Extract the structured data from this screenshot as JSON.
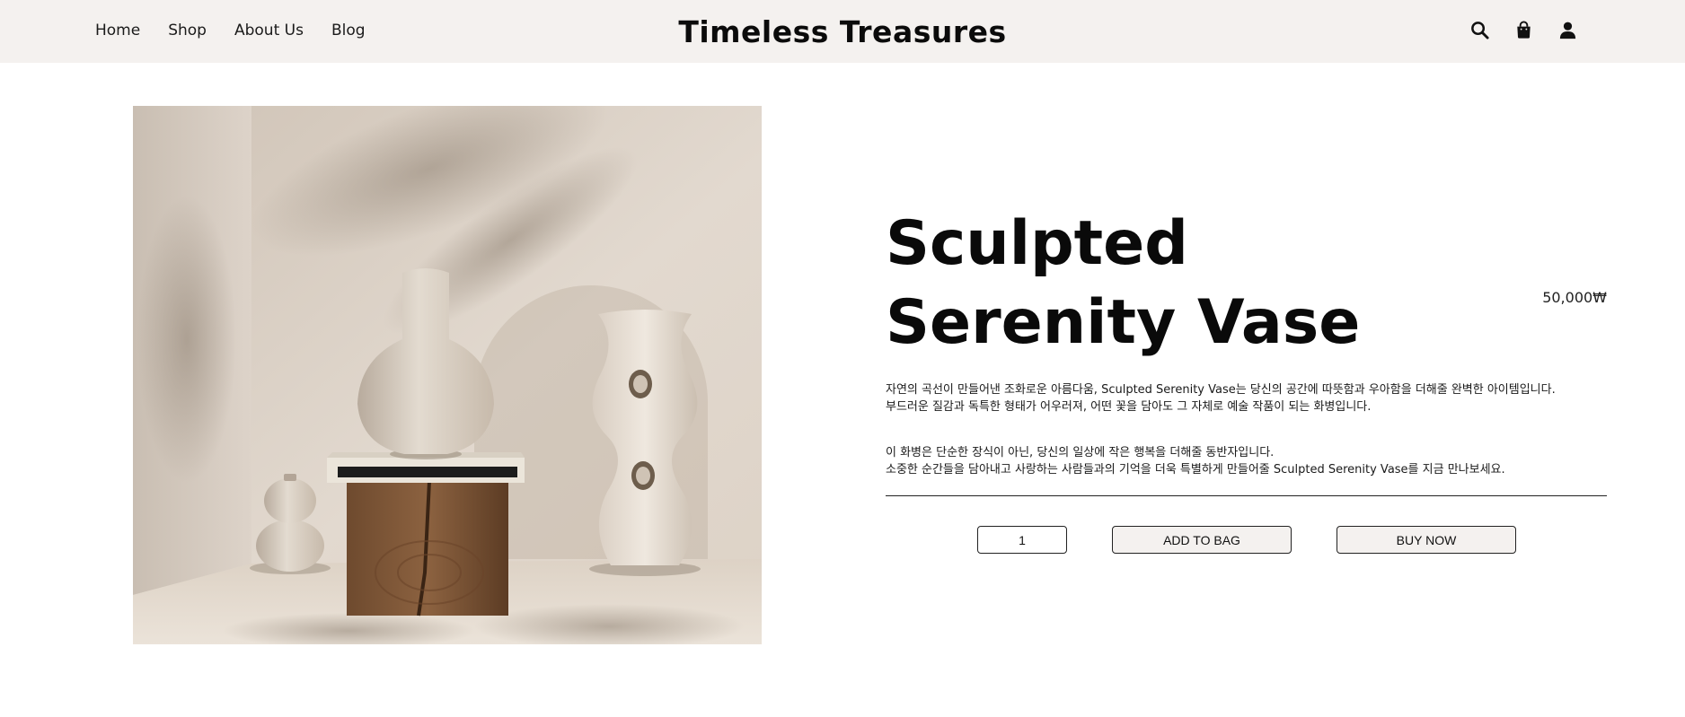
{
  "header": {
    "nav": [
      "Home",
      "Shop",
      "About Us",
      "Blog"
    ],
    "brand": "Timeless Treasures",
    "icons": [
      "search-icon",
      "bag-icon",
      "user-icon"
    ]
  },
  "product": {
    "title_line1": "Sculpted",
    "title_line2": "Serenity Vase",
    "price": "50,000₩",
    "desc1_line1": "자연의 곡선이 만들어낸 조화로운 아름다움, Sculpted Serenity Vase는 당신의 공간에 따뜻함과 우아함을 더해줄 완벽한 아이템입니다.",
    "desc1_line2": "부드러운 질감과 독특한 형태가 어우러져, 어떤 꽃을 담아도 그 자체로 예술 작품이 되는 화병입니다.",
    "desc2_line1": "이 화병은 단순한 장식이 아닌, 당신의 일상에 작은 행복을 더해줄 동반자입니다.",
    "desc2_line2": "소중한 순간들을 담아내고 사랑하는 사람들과의 기억을 더욱 특별하게 만들어줄 Sculpted Serenity Vase를 지금 만나보세요.",
    "quantity": "1",
    "add_to_bag": "ADD TO BAG",
    "buy_now": "BUY NOW"
  },
  "colors": {
    "header_bg": "#f4f1ef",
    "button_bg": "#f4f1ef",
    "text": "#111111"
  }
}
